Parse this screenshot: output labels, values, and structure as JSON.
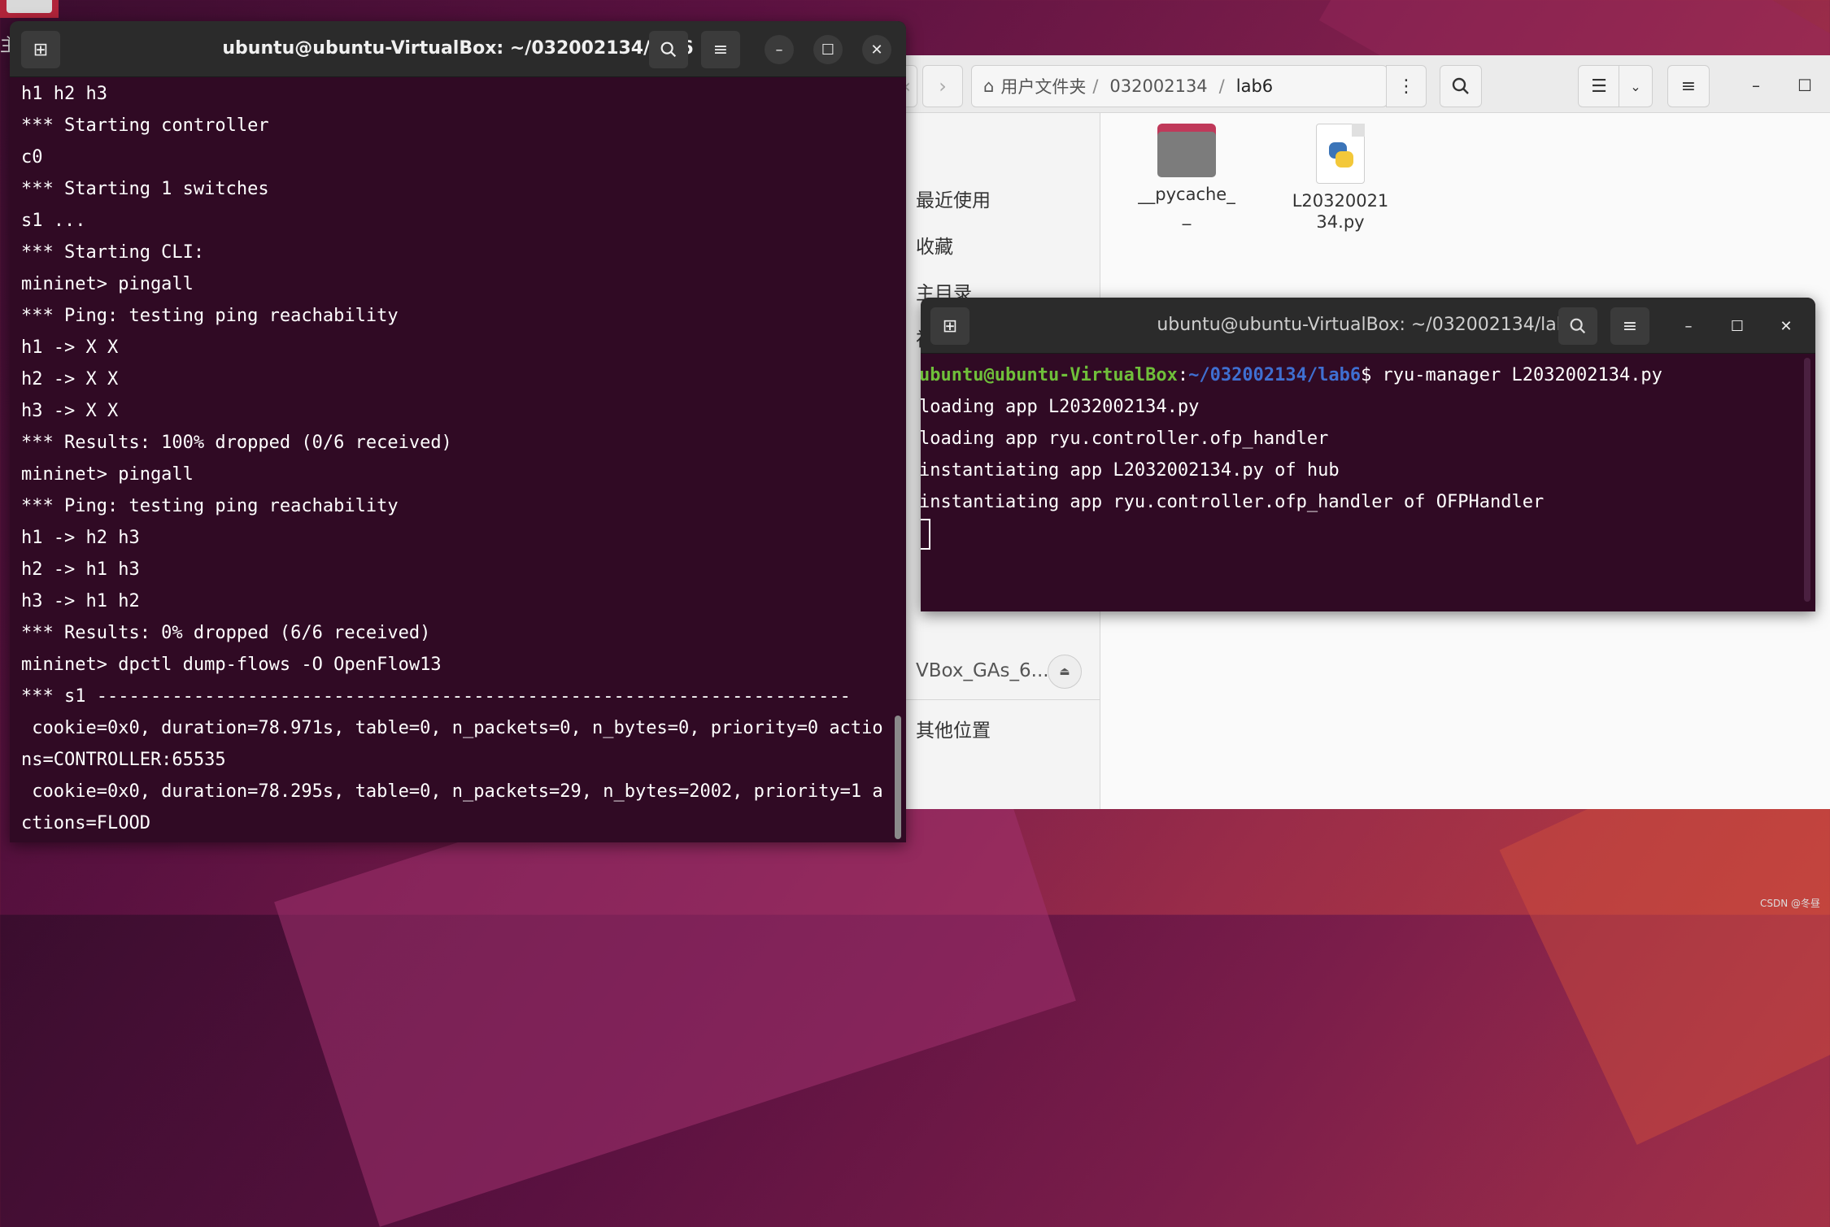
{
  "desktop": {
    "side_label": "主",
    "watermark": "CSDN @冬昼"
  },
  "files": {
    "path": {
      "home": "用户文件夹",
      "seg1": "032002134",
      "current": "lab6"
    },
    "sidebar": [
      {
        "label": "最近使用"
      },
      {
        "label": "收藏"
      },
      {
        "label": "主目录"
      },
      {
        "label": "视频"
      },
      {
        "label": "VBox_GAs_6...."
      },
      {
        "label": "其他位置"
      }
    ],
    "items": [
      {
        "name_l1": "__pycache_",
        "name_l2": "_",
        "icon": "folder-icon"
      },
      {
        "name_l1": "L20320021",
        "name_l2": "34.py",
        "icon": "python-file-icon"
      }
    ]
  },
  "term1": {
    "title": "ubuntu@ubuntu-VirtualBox: ~/032002134/lab6",
    "lines": [
      "h1 h2 h3",
      "*** Starting controller",
      "c0",
      "*** Starting 1 switches",
      "s1 ...",
      "*** Starting CLI:",
      "mininet> pingall",
      "*** Ping: testing ping reachability",
      "h1 -> X X",
      "h2 -> X X",
      "h3 -> X X",
      "*** Results: 100% dropped (0/6 received)",
      "mininet> pingall",
      "*** Ping: testing ping reachability",
      "h1 -> h2 h3",
      "h2 -> h1 h3",
      "h3 -> h1 h2",
      "*** Results: 0% dropped (6/6 received)",
      "mininet> dpctl dump-flows -O OpenFlow13",
      "*** s1 ----------------------------------------------------------------------",
      " cookie=0x0, duration=78.971s, table=0, n_packets=0, n_bytes=0, priority=0 actio",
      "ns=CONTROLLER:65535",
      " cookie=0x0, duration=78.295s, table=0, n_packets=29, n_bytes=2002, priority=1 a",
      "ctions=FLOOD"
    ]
  },
  "term2": {
    "title": "ubuntu@ubuntu-VirtualBox: ~/032002134/lab6",
    "prompt_user": "ubuntu@ubuntu-VirtualBox",
    "prompt_colon": ":",
    "prompt_path": "~/032002134/lab6",
    "prompt_cmd": "$ ryu-manager L2032002134.py",
    "lines": [
      "loading app L2032002134.py",
      "loading app ryu.controller.ofp_handler",
      "instantiating app L2032002134.py of hub",
      "instantiating app ryu.controller.ofp_handler of OFPHandler"
    ]
  }
}
